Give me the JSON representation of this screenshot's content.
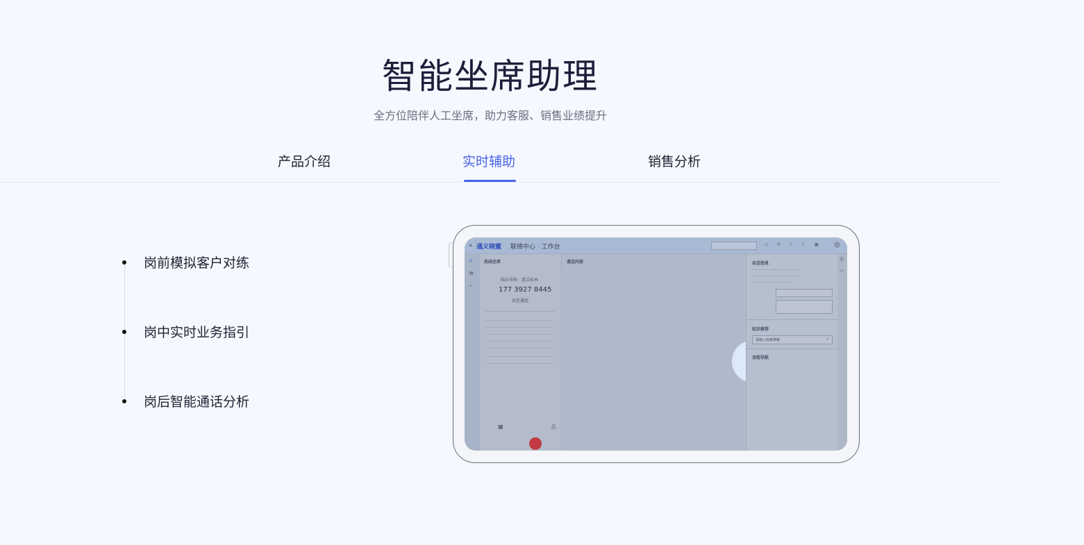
{
  "header": {
    "title": "智能坐席助理",
    "subtitle": "全方位陪伴人工坐席，助力客服、销售业绩提升"
  },
  "tabs": [
    {
      "label": "产品介绍",
      "active": false
    },
    {
      "label": "实时辅助",
      "active": true
    },
    {
      "label": "销售分析",
      "active": false
    }
  ],
  "features": [
    {
      "label": "岗前模拟客户对练"
    },
    {
      "label": "岗中实时业务指引"
    },
    {
      "label": "岗后智能通话分析"
    }
  ],
  "video": {
    "play_icon": "play-icon",
    "screen": {
      "app_brand": "通义晓蜜",
      "breadcrumb": "联络中心 · 工作台",
      "panel_left_title": "热线坐席",
      "caller_area": "陆丘号码 · 浙江杭州",
      "caller_phone": "177 3927 8445",
      "call_status": "正在通话",
      "panel_mid_title": "通话内容",
      "panel_right_title": "会话信息",
      "knowledge_title": "知识推荐",
      "search_placeholder": "请输入检索搜索",
      "process_title": "流程导航"
    }
  },
  "colors": {
    "accent": "#4a63e6",
    "background": "#f5f8fe",
    "title": "#1c1f3a"
  }
}
